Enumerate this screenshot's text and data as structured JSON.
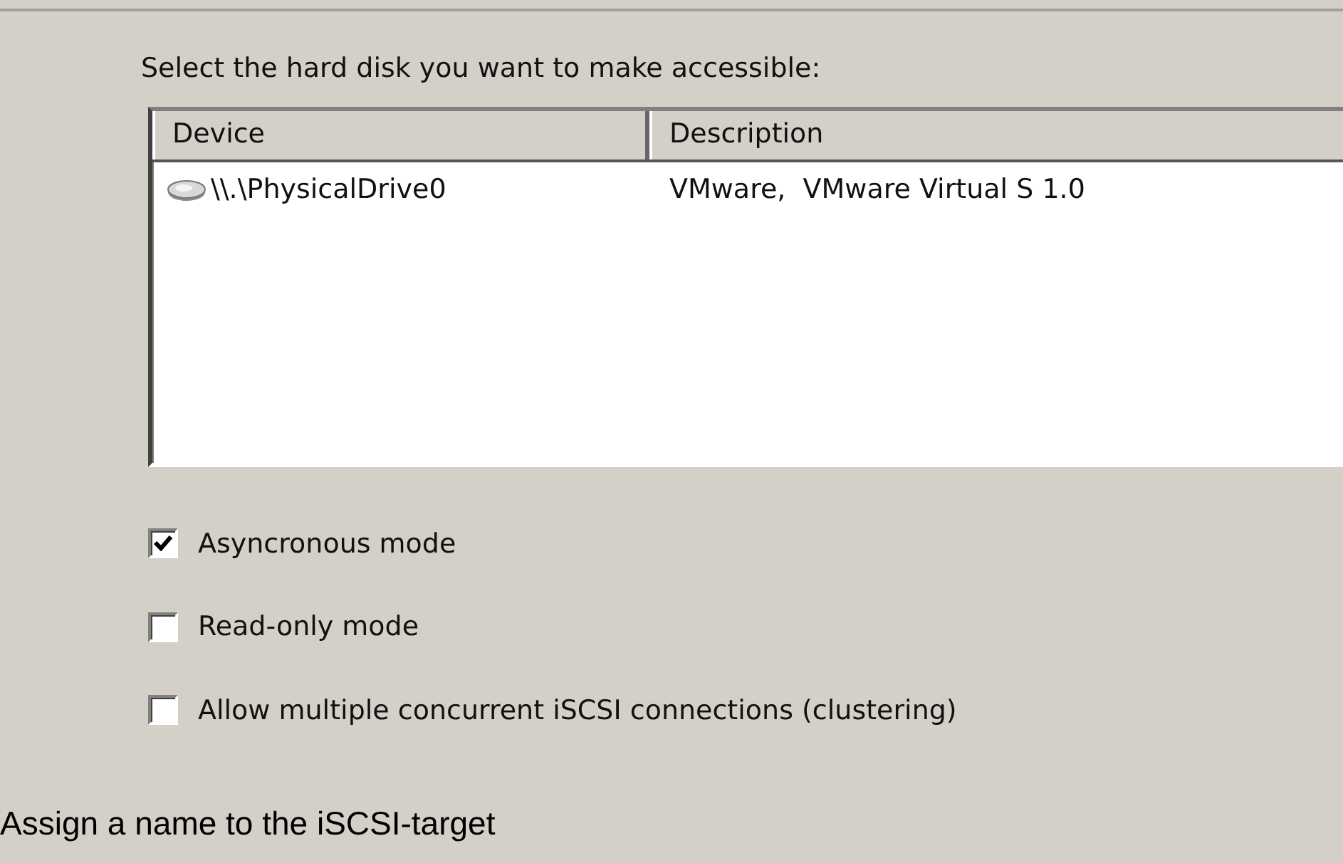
{
  "prompt": "Select the hard disk you want to make accessible:",
  "table": {
    "columns": [
      "Device",
      "Description"
    ],
    "rows": [
      {
        "device": "\\\\.\\PhysicalDrive0",
        "description": "VMware,  VMware Virtual S 1.0",
        "selected": false
      }
    ]
  },
  "options": [
    {
      "label": "Asyncronous mode",
      "checked": true
    },
    {
      "label": "Read-only mode",
      "checked": false
    },
    {
      "label": "Allow multiple concurrent iSCSI connections (clustering)",
      "checked": false
    }
  ],
  "caption": "Assign a name to the iSCSI-target"
}
